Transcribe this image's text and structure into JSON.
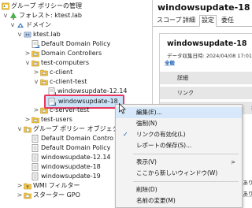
{
  "tree": {
    "items": [
      {
        "label": "グループ ポリシーの管理",
        "icon": "gpm-icon"
      },
      {
        "label": "フォレスト: ktest.lab",
        "icon": "forest-icon",
        "chev": "v"
      },
      {
        "label": "ドメイン",
        "icon": "domains-icon",
        "chev": "v"
      },
      {
        "label": "ktest.lab",
        "icon": "domain-icon",
        "chev": "v"
      },
      {
        "label": "Default Domain Policy",
        "icon": "gpo-link-icon"
      },
      {
        "label": "Domain Controllers",
        "icon": "ou-icon",
        "chev": ">"
      },
      {
        "label": "test-computers",
        "icon": "ou-icon",
        "chev": "v"
      },
      {
        "label": "c-client",
        "icon": "ou-icon",
        "chev": ">"
      },
      {
        "label": "c-client-test",
        "icon": "ou-icon",
        "chev": "v"
      },
      {
        "label": "windowsupdate-12.14",
        "icon": "gpo-link-icon"
      },
      {
        "label": "windowsupdate-18",
        "icon": "gpo-link-icon"
      },
      {
        "label": "c-server-test",
        "icon": "ou-icon",
        "chev": ">"
      },
      {
        "label": "test-users",
        "icon": "ou-icon",
        "chev": ">"
      },
      {
        "label": "グループ ポリシー オブジェクト",
        "icon": "gpo-folder-icon",
        "chev": "v"
      },
      {
        "label": "Default Domain Contro",
        "icon": "gpo-icon"
      },
      {
        "label": "Default Domain Policy",
        "icon": "gpo-icon"
      },
      {
        "label": "windowsupdate-12.14",
        "icon": "gpo-icon"
      },
      {
        "label": "windowsupdate-18",
        "icon": "gpo-icon"
      },
      {
        "label": "windowsupdate-19",
        "icon": "gpo-icon"
      },
      {
        "label": "WMI フィルター",
        "icon": "wmi-folder-icon",
        "chev": ">"
      },
      {
        "label": "スターター GPO",
        "icon": "starter-folder-icon",
        "chev": ">"
      }
    ]
  },
  "right_pane": {
    "title": "windowsupdate-18",
    "tabs": [
      "スコープ",
      "詳細",
      "設定",
      "委任"
    ],
    "active_tab": "設定",
    "card_title": "windowsupdate-18",
    "card_date": "データ収集日時: 2024/04/08 17:01",
    "all_label": "全般",
    "band1": "詳細",
    "band2": "リンク",
    "side_text1": "理",
    "side_text2": "設定はあり",
    "side_text3": "設定はあり"
  },
  "context_menu": {
    "items": [
      {
        "label": "編集(E)..."
      },
      {
        "label": "強制(N)"
      },
      {
        "label": "リンクの有効化(L)",
        "checked": true
      },
      {
        "label": "レポートの保存(S)..."
      },
      {
        "label": "表示(V)",
        "submenu": true
      },
      {
        "label": "ここから新しいウィンドウ(W)"
      },
      {
        "label": "削除(D)"
      },
      {
        "label": "名前の変更(M)"
      }
    ],
    "checkmark": "✓",
    "arrow": ">"
  }
}
